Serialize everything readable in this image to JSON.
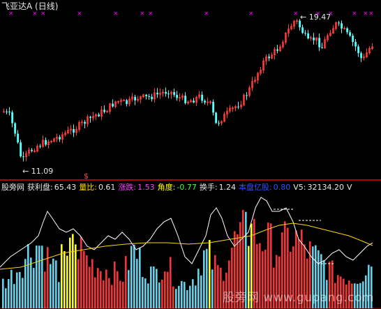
{
  "stock": {
    "name": "飞亚达A",
    "period": "(日线)",
    "high_label": "19.47",
    "low_label": "11.09"
  },
  "indicator": {
    "name": "股旁网",
    "fields": [
      {
        "label": "获利盘:",
        "value": "65.43",
        "label_color": "#e8e8e8",
        "value_color": "#e8e8e8"
      },
      {
        "label": "量比:",
        "value": "0.61",
        "label_color": "#ffd700",
        "value_color": "#e8e8e8"
      },
      {
        "label": "涨跌:",
        "value": "1.53",
        "label_color": "#ff40ff",
        "value_color": "#ff40ff"
      },
      {
        "label": "角度:",
        "value": "-0.77",
        "label_color": "#ffff00",
        "value_color": "#40ff40"
      },
      {
        "label": "换手:",
        "value": "1.24",
        "label_color": "#e8e8e8",
        "value_color": "#e8e8e8"
      },
      {
        "label": "本盘亿股:",
        "value": "0.80",
        "label_color": "#3050ff",
        "value_color": "#3050ff"
      },
      {
        "label": "V5:",
        "value": "32134.20",
        "label_color": "#e8e8e8",
        "value_color": "#e8e8e8"
      },
      {
        "label": "V",
        "value": "",
        "label_color": "#e8e8e8",
        "value_color": "#e8e8e8"
      }
    ]
  },
  "watermark": "股旁网 www.gupang.com",
  "colors": {
    "up": "#ff3c3c",
    "down": "#54ffff",
    "signal": "#ff00ff",
    "bar_red": "#ff3030",
    "bar_cyan": "#58d8f0",
    "bar_yellow": "#ffff00",
    "line_white": "#ffffff",
    "line_yellow": "#ffd700"
  }
}
